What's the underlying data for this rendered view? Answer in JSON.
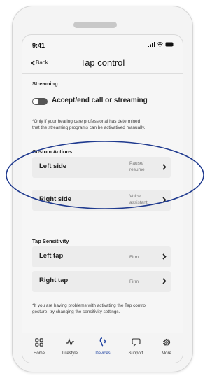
{
  "status": {
    "time": "9:41"
  },
  "nav": {
    "back_label": "Back",
    "title": "Tap control"
  },
  "streaming": {
    "heading": "Streaming",
    "toggle_label": "Accept/end call or streaming",
    "toggle_on": false,
    "note_line1": "*Only if your hearing care professional has determined",
    "note_line2": "that the streaming programs can be activatived manually."
  },
  "custom_actions": {
    "heading": "Custom Actions",
    "rows": [
      {
        "label": "Left side",
        "value_line1": "Pause/",
        "value_line2": "resume"
      },
      {
        "label": "Right side",
        "value_line1": "Voice",
        "value_line2": "assistant"
      }
    ]
  },
  "tap_sensitivity": {
    "heading": "Tap Sensitivity",
    "rows": [
      {
        "label": "Left tap",
        "value": "Firm"
      },
      {
        "label": "Right tap",
        "value": "Firm"
      }
    ],
    "note_line1": "*If you are having problems with activating the Tap control",
    "note_line2": "gesture, try changing the sensitivity settings."
  },
  "tabs": [
    {
      "label": "Home",
      "icon": "home-icon",
      "active": false
    },
    {
      "label": "Lifestyle",
      "icon": "lifestyle-icon",
      "active": false
    },
    {
      "label": "Devices",
      "icon": "devices-icon",
      "active": true
    },
    {
      "label": "Support",
      "icon": "support-icon",
      "active": false
    },
    {
      "label": "More",
      "icon": "gear-icon",
      "active": false
    }
  ],
  "colors": {
    "accent": "#1b3fa0",
    "annotation_oval": "#1f3a8f"
  }
}
